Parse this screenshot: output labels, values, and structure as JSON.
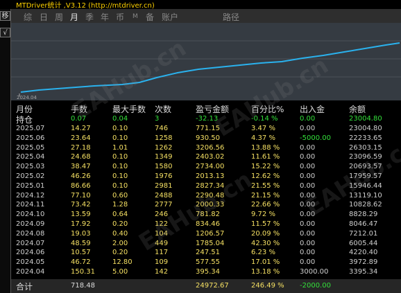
{
  "window": {
    "title": "MTDriver统计 ,V3.12 (http://mtdriver.cn)"
  },
  "left_toolbar": {
    "btn1": "移",
    "btn2": "√"
  },
  "tabs": [
    {
      "label": "综",
      "active": false
    },
    {
      "label": "日",
      "active": false
    },
    {
      "label": "周",
      "active": false
    },
    {
      "label": "月",
      "active": true
    },
    {
      "label": "季",
      "active": false
    },
    {
      "label": "年",
      "active": false
    },
    {
      "label": "币",
      "active": false
    },
    {
      "label": "M",
      "active": false
    },
    {
      "label": "备",
      "active": false
    },
    {
      "label": "账户",
      "active": false
    },
    {
      "label": "路径",
      "active": false
    }
  ],
  "chart": {
    "x_label": "2024.04",
    "line_color": "#2ab2ee"
  },
  "table": {
    "headers": [
      "月份",
      "手数",
      "最大手数",
      "次数",
      "盈亏金额",
      "百分比%",
      "出入金",
      "余额"
    ],
    "holding": [
      "持仓",
      "0.07",
      "0.04",
      "3",
      "-32.13",
      "-0.14 %",
      "0.00",
      "23004.80"
    ],
    "rows": [
      [
        "2025.07",
        "14.27",
        "0.10",
        "746",
        "771.15",
        "3.47 %",
        "0.00",
        "23004.80"
      ],
      [
        "2025.06",
        "23.64",
        "0.10",
        "1258",
        "930.50",
        "4.37 %",
        "-5000.00",
        "22233.65"
      ],
      [
        "2025.05",
        "27.18",
        "1.01",
        "1262",
        "3206.56",
        "13.88 %",
        "0.00",
        "26303.15"
      ],
      [
        "2025.04",
        "24.68",
        "0.10",
        "1349",
        "2403.02",
        "11.61 %",
        "0.00",
        "23096.59"
      ],
      [
        "2025.03",
        "38.47",
        "0.10",
        "1580",
        "2734.00",
        "15.22 %",
        "0.00",
        "20693.57"
      ],
      [
        "2025.02",
        "46.26",
        "0.10",
        "1976",
        "2013.13",
        "12.62 %",
        "0.00",
        "17959.57"
      ],
      [
        "2025.01",
        "86.66",
        "0.10",
        "2981",
        "2827.34",
        "21.55 %",
        "0.00",
        "15946.44"
      ],
      [
        "2024.12",
        "77.10",
        "0.60",
        "2488",
        "2290.48",
        "21.15 %",
        "0.00",
        "13119.10"
      ],
      [
        "2024.11",
        "73.42",
        "1.28",
        "2777",
        "2000.33",
        "22.66 %",
        "0.00",
        "10828.62"
      ],
      [
        "2024.10",
        "13.59",
        "0.64",
        "246",
        "781.82",
        "9.72 %",
        "0.00",
        "8828.29"
      ],
      [
        "2024.09",
        "17.92",
        "0.20",
        "122",
        "834.46",
        "11.57 %",
        "0.00",
        "8046.47"
      ],
      [
        "2024.08",
        "19.03",
        "0.40",
        "104",
        "1206.57",
        "20.09 %",
        "0.00",
        "7212.01"
      ],
      [
        "2024.07",
        "48.59",
        "2.00",
        "449",
        "1785.04",
        "42.30 %",
        "0.00",
        "6005.44"
      ],
      [
        "2024.06",
        "10.57",
        "0.20",
        "117",
        "247.51",
        "6.23 %",
        "0.00",
        "4220.40"
      ],
      [
        "2024.05",
        "46.72",
        "12.80",
        "109",
        "577.55",
        "17.01 %",
        "0.00",
        "3972.89"
      ],
      [
        "2024.04",
        "150.31",
        "5.00",
        "142",
        "395.34",
        "13.18 %",
        "3000.00",
        "3395.34"
      ]
    ],
    "total": [
      "合计",
      "718.48",
      "",
      "",
      "24972.67",
      "246.49 %",
      "-2000.00",
      ""
    ]
  },
  "colors": {
    "date": "#d0d0d0",
    "lots": "#f5e063",
    "count": "#f5e063",
    "profit": "#f5e063",
    "percent": "#f5e063",
    "deposit": "#d0d0d0",
    "deposit_neg": "#33e03a",
    "balance": "#d0d0d0",
    "holding": "#33e03a",
    "chart_bg": "#353b42"
  },
  "watermark": "EAHub.cn"
}
